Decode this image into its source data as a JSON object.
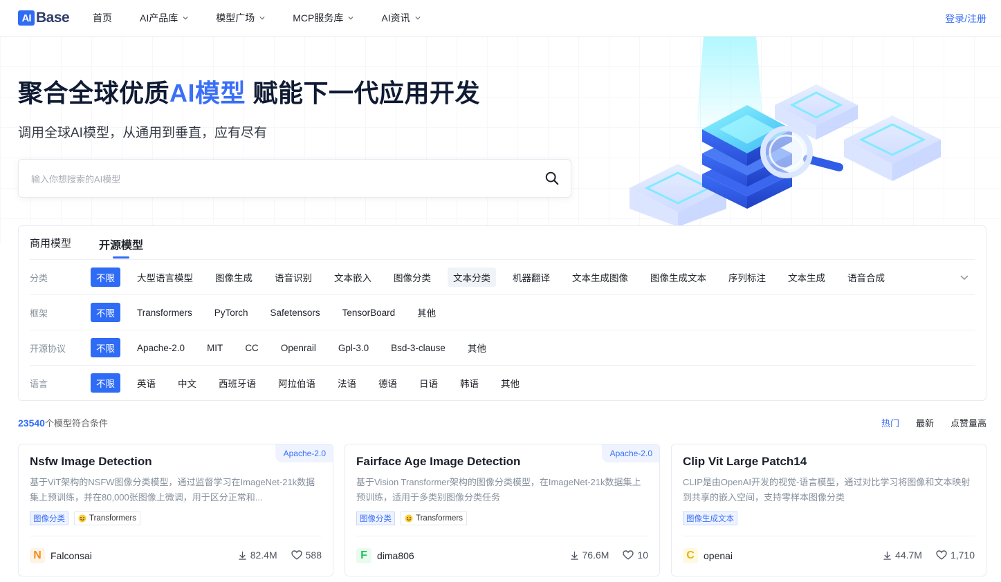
{
  "brand": {
    "logo_mark": "AI",
    "logo_text": "Base"
  },
  "nav": {
    "items": [
      {
        "label": "首页",
        "dropdown": false
      },
      {
        "label": "AI产品库",
        "dropdown": true
      },
      {
        "label": "模型广场",
        "dropdown": true
      },
      {
        "label": "MCP服务库",
        "dropdown": true
      },
      {
        "label": "AI资讯",
        "dropdown": true
      }
    ],
    "login": "登录/注册"
  },
  "hero": {
    "title_pre": "聚合全球优质",
    "title_hl": "AI模型",
    "title_post": " 赋能下一代应用开发",
    "subtitle": "调用全球AI模型，从通用到垂直，应有尽有",
    "search_placeholder": "输入你想搜索的AI模型"
  },
  "tabs": [
    "商用模型",
    "开源模型"
  ],
  "active_tab": "开源模型",
  "filters": [
    {
      "label": "分类",
      "options": [
        "不限",
        "大型语言模型",
        "图像生成",
        "语音识别",
        "文本嵌入",
        "图像分类",
        "文本分类",
        "机器翻译",
        "文本生成图像",
        "图像生成文本",
        "序列标注",
        "文本生成",
        "语音合成"
      ],
      "selected": "不限",
      "hover": "文本分类",
      "expandable": true
    },
    {
      "label": "框架",
      "options": [
        "不限",
        "Transformers",
        "PyTorch",
        "Safetensors",
        "TensorBoard",
        "其他"
      ],
      "selected": "不限"
    },
    {
      "label": "开源协议",
      "options": [
        "不限",
        "Apache-2.0",
        "MIT",
        "CC",
        "Openrail",
        "Gpl-3.0",
        "Bsd-3-clause",
        "其他"
      ],
      "selected": "不限"
    },
    {
      "label": "语言",
      "options": [
        "不限",
        "英语",
        "中文",
        "西班牙语",
        "阿拉伯语",
        "法语",
        "德语",
        "日语",
        "韩语",
        "其他"
      ],
      "selected": "不限"
    }
  ],
  "results": {
    "count": "23540",
    "count_suffix": "个模型符合条件"
  },
  "sorts": [
    {
      "label": "热门",
      "active": true
    },
    {
      "label": "最新",
      "active": false
    },
    {
      "label": "点赞量高",
      "active": false
    }
  ],
  "cards": [
    {
      "title": "Nsfw Image Detection",
      "license": "Apache-2.0",
      "desc": "基于ViT架构的NSFW图像分类模型，通过监督学习在ImageNet-21k数据集上预训练，并在80,000张图像上微调，用于区分正常和...",
      "tags": [
        "图像分类"
      ],
      "framework": "Transformers",
      "author": "Falconsai",
      "avatar_letter": "N",
      "avatar_color": "#f28c1f",
      "avatar_bg": "#fff3e6",
      "downloads": "82.4M",
      "likes": "588"
    },
    {
      "title": "Fairface Age Image Detection",
      "license": "Apache-2.0",
      "desc": "基于Vision Transformer架构的图像分类模型，在ImageNet-21k数据集上预训练，适用于多类别图像分类任务",
      "tags": [
        "图像分类"
      ],
      "framework": "Transformers",
      "author": "dima806",
      "avatar_letter": "F",
      "avatar_color": "#22c55e",
      "avatar_bg": "#e9fbef",
      "downloads": "76.6M",
      "likes": "10"
    },
    {
      "title": "Clip Vit Large Patch14",
      "license": "",
      "desc": "CLIP是由OpenAI开发的视觉-语言模型，通过对比学习将图像和文本映射到共享的嵌入空间，支持零样本图像分类",
      "tags": [
        "图像生成文本"
      ],
      "framework": "",
      "author": "openai",
      "avatar_letter": "C",
      "avatar_color": "#eab308",
      "avatar_bg": "#fef9e3",
      "downloads": "44.7M",
      "likes": "1,710"
    }
  ],
  "colors": {
    "accent": "#2f6cf6",
    "link": "#3a6ff7",
    "muted": "#86909c"
  }
}
